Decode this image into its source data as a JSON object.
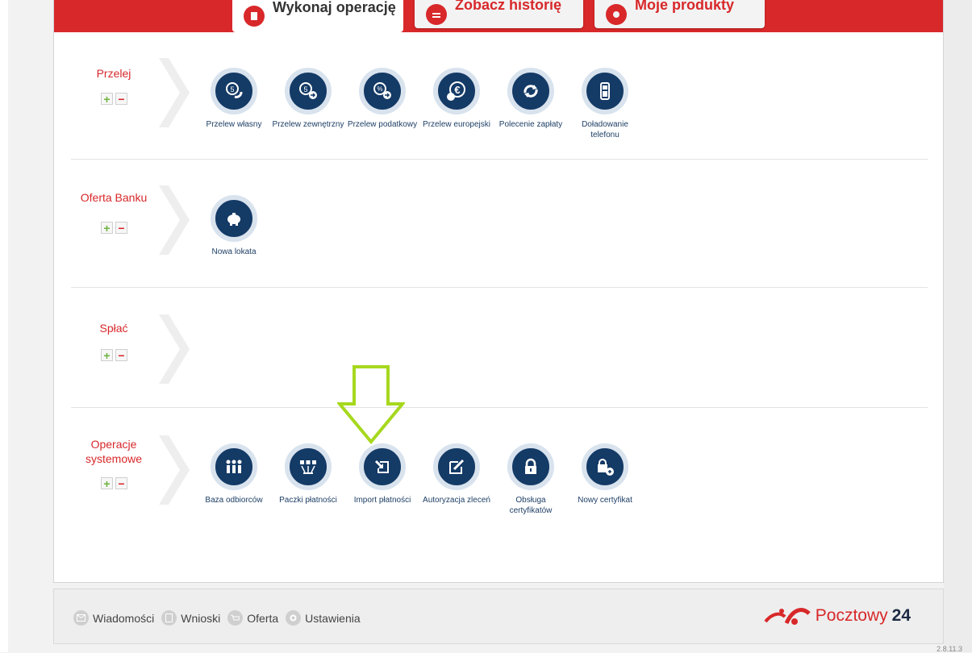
{
  "tabs": [
    {
      "label": "Wykonaj operację",
      "icon": "document-icon"
    },
    {
      "label": "Zobacz historię",
      "icon": "history-icon"
    },
    {
      "label": "Moje produkty",
      "icon": "products-icon"
    }
  ],
  "sections": [
    {
      "title": "Przelej",
      "items": [
        {
          "label": "Przelew własny",
          "icon": "coin-return-icon"
        },
        {
          "label": "Przelew zewnętrzny",
          "icon": "coin-arrow-icon"
        },
        {
          "label": "Przelew podatkowy",
          "icon": "percent-coin-icon"
        },
        {
          "label": "Przelew europejski",
          "icon": "euro-icon"
        },
        {
          "label": "Polecenie zapłaty",
          "icon": "refresh-icon"
        },
        {
          "label": "Doładowanie telefonu",
          "icon": "mobile-phone-icon"
        }
      ]
    },
    {
      "title": "Oferta Banku",
      "items": [
        {
          "label": "Nowa lokata",
          "icon": "piggy-bank-icon"
        }
      ]
    },
    {
      "title": "Spłać",
      "items": []
    },
    {
      "title": "Operacje systemowe",
      "items": [
        {
          "label": "Baza odbiorców",
          "icon": "people-icon"
        },
        {
          "label": "Paczki płatności",
          "icon": "payment-batch-icon"
        },
        {
          "label": "Import płatności",
          "icon": "import-icon"
        },
        {
          "label": "Autoryzacja zleceń",
          "icon": "edit-icon"
        },
        {
          "label": "Obsługa certyfikatów",
          "icon": "lock-icon"
        },
        {
          "label": "Nowy certyfikat",
          "icon": "new-certificate-icon"
        }
      ]
    }
  ],
  "expand_symbol": "+",
  "collapse_symbol": "−",
  "footer": {
    "links": [
      {
        "label": "Wiadomości",
        "icon": "envelope-icon"
      },
      {
        "label": "Wnioski",
        "icon": "form-icon"
      },
      {
        "label": "Oferta",
        "icon": "cart-icon"
      },
      {
        "label": "Ustawienia",
        "icon": "gear-icon"
      }
    ],
    "logo_text": "Pocztowy",
    "logo_number": "24"
  },
  "version": "2.8.11.3",
  "colors": {
    "brand_red": "#d8282a",
    "icon_navy": "#143a66",
    "highlight_arrow": "#a6d81e"
  }
}
